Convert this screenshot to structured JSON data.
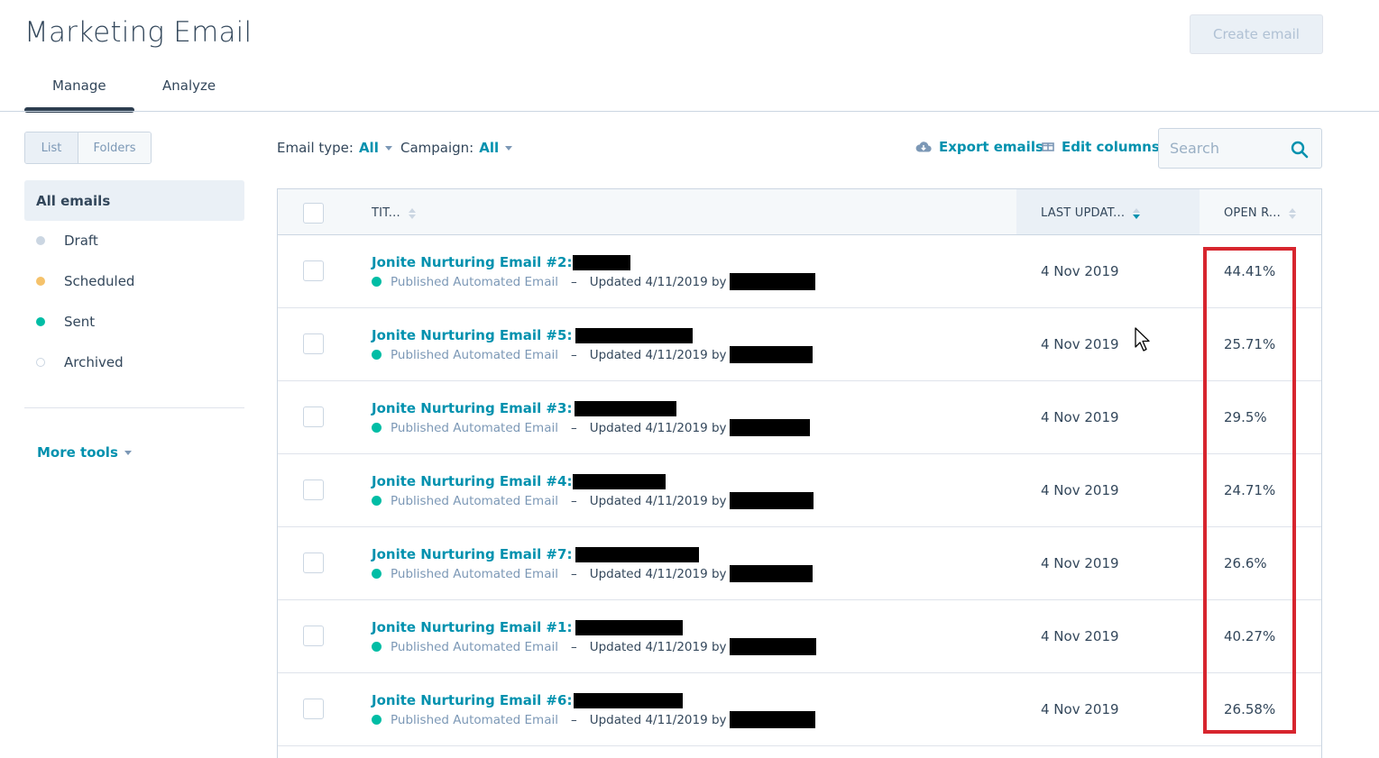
{
  "header": {
    "title": "Marketing Email",
    "create_button": "Create email"
  },
  "tabs": [
    {
      "label": "Manage",
      "active": true
    },
    {
      "label": "Analyze",
      "active": false
    }
  ],
  "view_toggle": {
    "list": "List",
    "folders": "Folders"
  },
  "sidebar": {
    "active": "All emails",
    "items": [
      {
        "label": "Draft",
        "color": "#cbd6e2"
      },
      {
        "label": "Scheduled",
        "color": "#f5c26b"
      },
      {
        "label": "Sent",
        "color": "#00bda5"
      },
      {
        "label": "Archived",
        "color": "#ffffff"
      }
    ],
    "more_tools": "More tools"
  },
  "toolbar": {
    "email_type_label": "Email type:",
    "email_type_value": "All",
    "campaign_label": "Campaign:",
    "campaign_value": "All",
    "export": "Export emails",
    "edit_columns": "Edit columns",
    "search_placeholder": "Search"
  },
  "table": {
    "columns": [
      "TIT...",
      "LAST UPDAT...",
      "OPEN R..."
    ],
    "rows": [
      {
        "title": "Jonite Nurturing Email #2:",
        "status": "Published Automated Email",
        "updated": "Updated 4/11/2019 by",
        "date": "4 Nov 2019",
        "open_rate": "44.41%"
      },
      {
        "title": "Jonite Nurturing Email #5:",
        "status": "Published Automated Email",
        "updated": "Updated 4/11/2019 by",
        "date": "4 Nov 2019",
        "open_rate": "25.71%"
      },
      {
        "title": "Jonite Nurturing Email #3:",
        "status": "Published Automated Email",
        "updated": "Updated 4/11/2019 by",
        "date": "4 Nov 2019",
        "open_rate": "29.5%"
      },
      {
        "title": "Jonite Nurturing Email #4:",
        "status": "Published Automated Email",
        "updated": "Updated 4/11/2019 by",
        "date": "4 Nov 2019",
        "open_rate": "24.71%"
      },
      {
        "title": "Jonite Nurturing Email #7:",
        "status": "Published Automated Email",
        "updated": "Updated 4/11/2019 by",
        "date": "4 Nov 2019",
        "open_rate": "26.6%"
      },
      {
        "title": "Jonite Nurturing Email #1:",
        "status": "Published Automated Email",
        "updated": "Updated 4/11/2019 by",
        "date": "4 Nov 2019",
        "open_rate": "40.27%"
      },
      {
        "title": "Jonite Nurturing Email #6:",
        "status": "Published Automated Email",
        "updated": "Updated 4/11/2019 by",
        "date": "4 Nov 2019",
        "open_rate": "26.58%"
      }
    ]
  },
  "colors": {
    "accent": "#0091ae",
    "text": "#33475b",
    "status_published": "#00bda5",
    "highlight": "#d7252e"
  }
}
